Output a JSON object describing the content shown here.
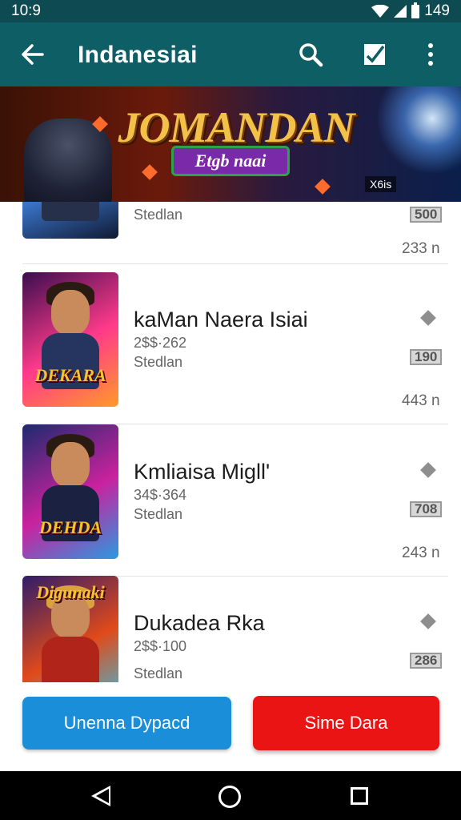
{
  "status_bar": {
    "time": "10:9",
    "battery": "149"
  },
  "app_bar": {
    "title": "Indanesiai",
    "icons": [
      "back-arrow-icon",
      "search-icon",
      "edit-icon",
      "more-vert-icon"
    ]
  },
  "banner": {
    "title": "JOMANDAN",
    "subtitle": "Etgb naai",
    "badge": "X6is"
  },
  "list": {
    "items": [
      {
        "name": "",
        "price": "",
        "status": "Stedlan",
        "badge": "500",
        "size": "233 n",
        "colors": [
          "#1b2d5a",
          "#3a73c8"
        ]
      },
      {
        "name": "kaMan Naera Isiai",
        "price": "2$$·262",
        "status": "Stedlan",
        "badge": "190",
        "size": "443 n",
        "thumb_text": "DEKARA",
        "colors": [
          "#3a0d4e",
          "#ff3a8a"
        ]
      },
      {
        "name": "Kmliaisa Migll'",
        "price": "34$·364",
        "status": "Stedlan",
        "badge": "708",
        "size": "243 n",
        "thumb_text": "DEHDA",
        "colors": [
          "#1c2a6e",
          "#c9229e"
        ]
      },
      {
        "name": "Dukadea Rka",
        "price": "2$$·100",
        "status": "Stedlan",
        "badge": "286",
        "size": "",
        "thumb_text": "Digunaki",
        "colors": [
          "#2f1c6a",
          "#e04a1a"
        ]
      }
    ]
  },
  "buttons": {
    "primary": "Unenna Dypacd",
    "danger": "Sime Dara"
  },
  "colors": {
    "app_bar": "#0e5e66",
    "status_bar": "#0d4a52",
    "primary": "#1a8ed8",
    "danger": "#ea1414"
  }
}
